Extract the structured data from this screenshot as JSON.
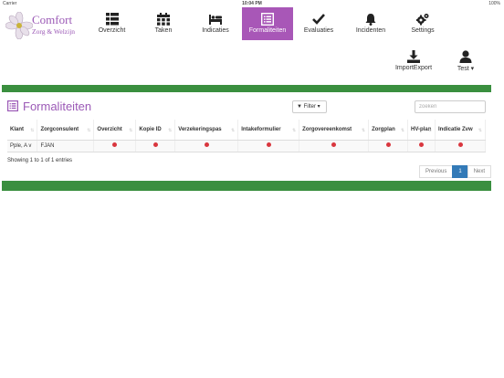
{
  "statusbar": {
    "carrier": "Carrier",
    "time": "10:04 PM",
    "battery": "100%"
  },
  "logo": {
    "line1": "Comfort",
    "line2": "Zorg & Welzijn"
  },
  "nav": {
    "items": [
      {
        "label": "Overzicht",
        "icon": "grid-list-icon"
      },
      {
        "label": "Taken",
        "icon": "calendar-icon"
      },
      {
        "label": "Indicaties",
        "icon": "bed-icon"
      },
      {
        "label": "Formaliteiten",
        "icon": "list-alt-icon"
      },
      {
        "label": "Evaluaties",
        "icon": "checkmark-icon"
      },
      {
        "label": "Incidenten",
        "icon": "bell-icon"
      },
      {
        "label": "Settings",
        "icon": "gears-icon"
      }
    ],
    "active": "Formaliteiten"
  },
  "subnav": {
    "import_label": "ImportExport",
    "user_label": "Test"
  },
  "page": {
    "title": "Formaliteiten",
    "filter_label": "Filter",
    "search_placeholder": "zoeken"
  },
  "table": {
    "columns": [
      "Klant",
      "Zorgconsulent",
      "Overzicht",
      "Kopie ID",
      "Verzekeringspas",
      "Intakeformulier",
      "Zorgovereenkomst",
      "Zorgplan",
      "HV-plan",
      "Indicatie Zvw"
    ],
    "rows": [
      {
        "klant": "Pple, A v",
        "zorgconsulent": "FJAN",
        "statuses": [
          "red",
          "red",
          "red",
          "red",
          "red",
          "red",
          "red",
          "red"
        ]
      }
    ]
  },
  "info": "Showing 1 to 1 of 1 entries",
  "pagination": {
    "previous": "Previous",
    "current": "1",
    "next": "Next"
  },
  "colors": {
    "accent": "#a857b7",
    "bar": "#3a8f3f",
    "status_red": "#d9363e",
    "page_active": "#337ab7"
  }
}
